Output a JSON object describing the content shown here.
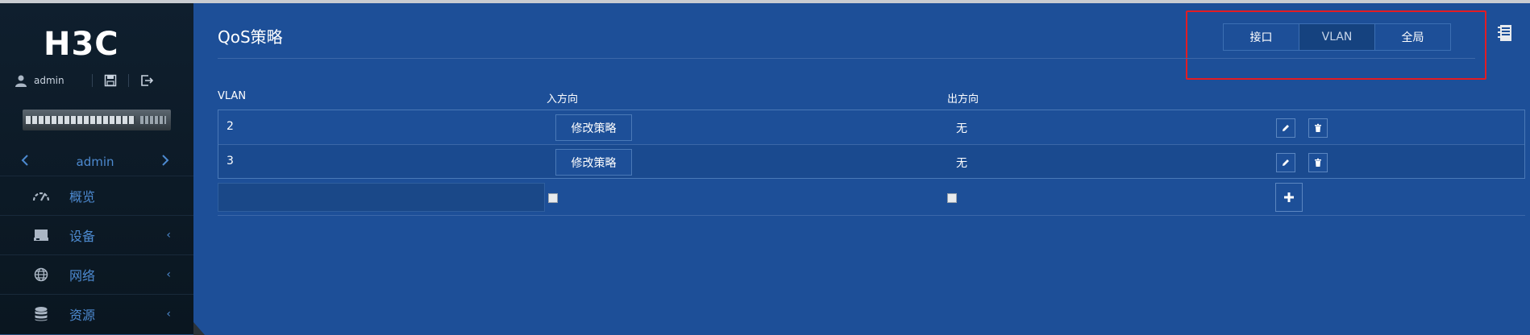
{
  "sidebar": {
    "logo": "H3C",
    "user": "admin",
    "device_name": "admin",
    "items": [
      {
        "label": "概览",
        "icon": "dashboard-icon"
      },
      {
        "label": "设备",
        "icon": "device-icon"
      },
      {
        "label": "网络",
        "icon": "globe-icon"
      },
      {
        "label": "资源",
        "icon": "database-icon"
      }
    ]
  },
  "main": {
    "title": "QoS策略",
    "tabs": [
      {
        "label": "接口",
        "active": false
      },
      {
        "label": "VLAN",
        "active": true
      },
      {
        "label": "全局",
        "active": false
      }
    ],
    "table": {
      "headers": [
        "VLAN",
        "入方向",
        "出方向"
      ],
      "rows": [
        {
          "vlan": "2",
          "in_button": "修改策略",
          "out": "无"
        },
        {
          "vlan": "3",
          "in_button": "修改策略",
          "out": "无"
        }
      ]
    }
  },
  "colors": {
    "main_bg": "#1d4f98",
    "sidebar_bg": "#0f1f2e",
    "accent_text": "#4d8ad0",
    "highlight": "#e31c23"
  }
}
